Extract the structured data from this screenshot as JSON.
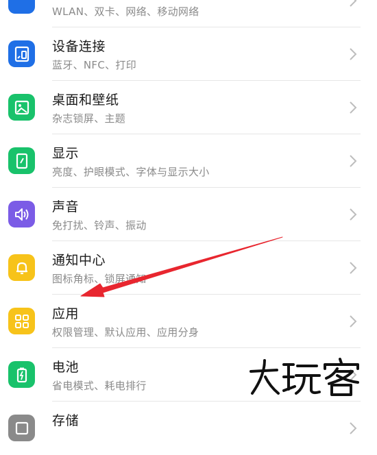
{
  "settings": {
    "items": [
      {
        "title": "",
        "subtitle": "WLAN、双卡、网络、移动网络",
        "icon": "network-icon",
        "color": "#1f6fe6"
      },
      {
        "title": "设备连接",
        "subtitle": "蓝牙、NFC、打印",
        "icon": "device-connection-icon",
        "color": "#1f6fe6"
      },
      {
        "title": "桌面和壁纸",
        "subtitle": "杂志锁屏、主题",
        "icon": "wallpaper-icon",
        "color": "#19c26b"
      },
      {
        "title": "显示",
        "subtitle": "亮度、护眼模式、字体与显示大小",
        "icon": "display-icon",
        "color": "#19c26b"
      },
      {
        "title": "声音",
        "subtitle": "免打扰、铃声、振动",
        "icon": "sound-icon",
        "color": "#7b5ce6"
      },
      {
        "title": "通知中心",
        "subtitle": "图标角标、锁屏通知",
        "icon": "bell-icon",
        "color": "#f7c31a"
      },
      {
        "title": "应用",
        "subtitle": "权限管理、默认应用、应用分身",
        "icon": "apps-grid-icon",
        "color": "#f7c31a"
      },
      {
        "title": "电池",
        "subtitle": "省电模式、耗电排行",
        "icon": "battery-icon",
        "color": "#19c26b"
      },
      {
        "title": "存储",
        "subtitle": "",
        "icon": "storage-icon",
        "color": "#8a8a8a"
      }
    ]
  },
  "annotation": {
    "arrow_color": "#e8262f",
    "target": "应用"
  },
  "watermark": {
    "text": "大玩客"
  }
}
